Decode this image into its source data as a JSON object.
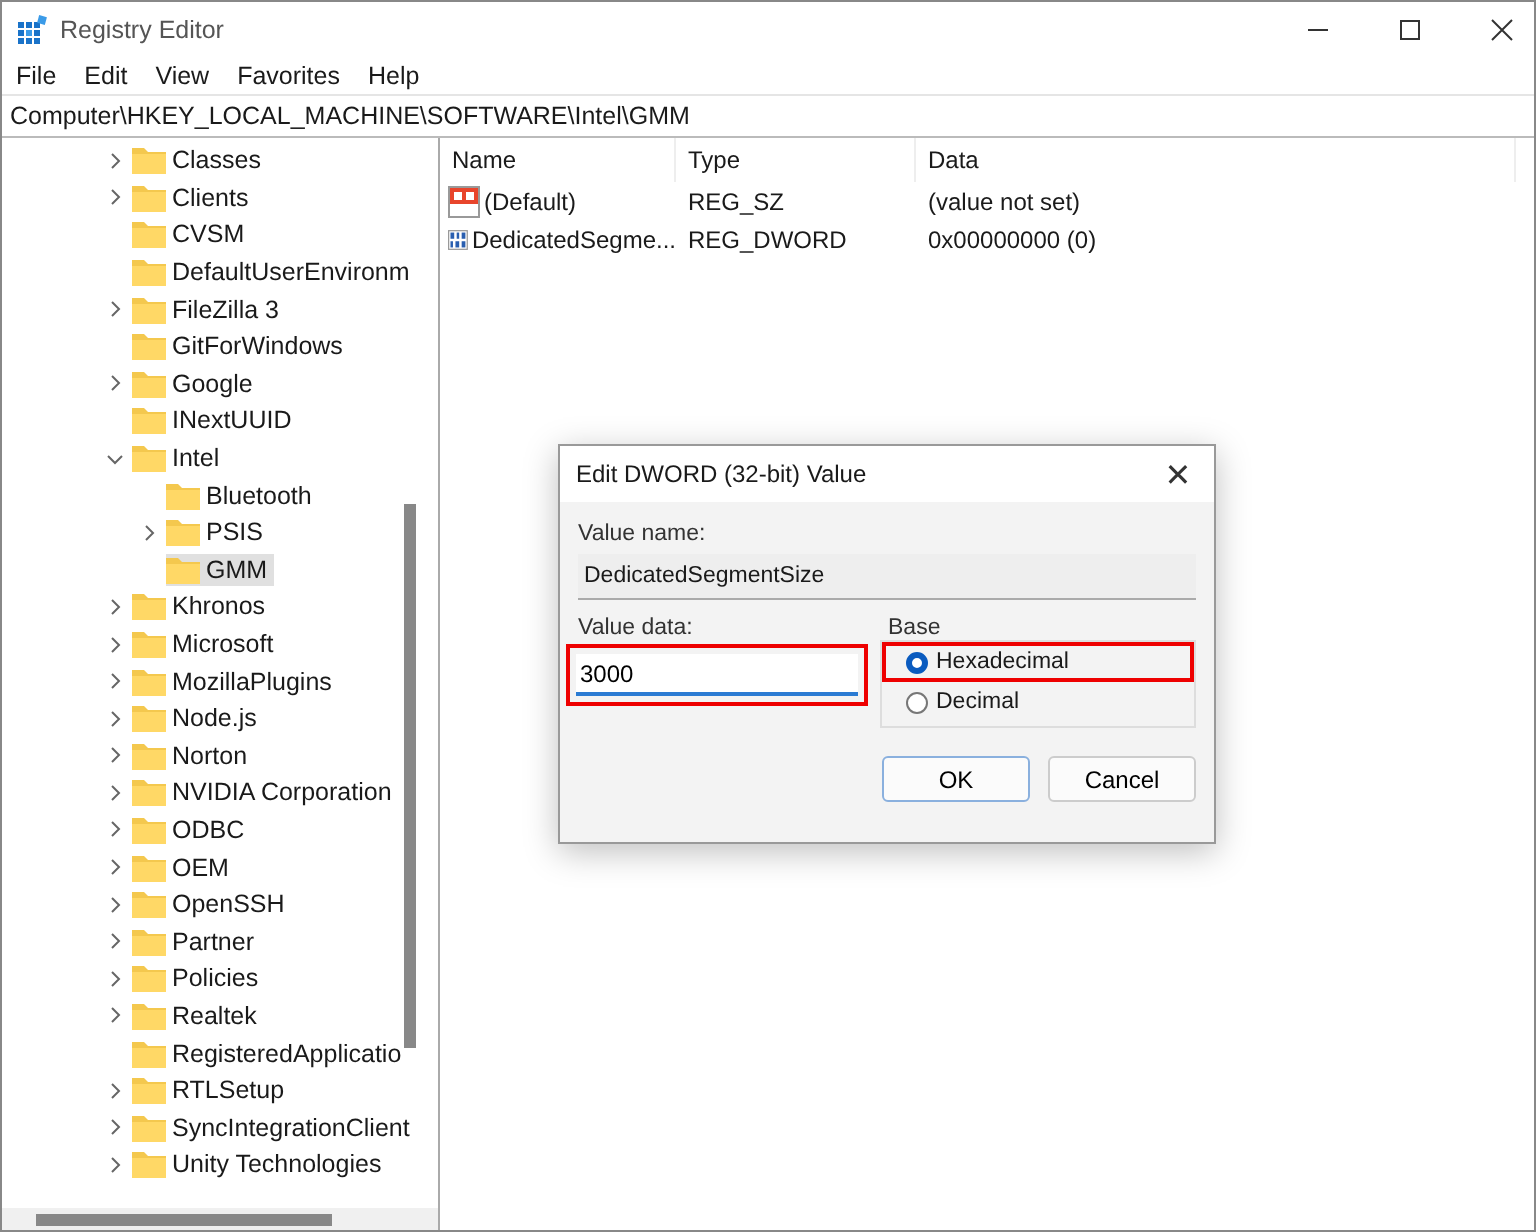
{
  "window": {
    "title": "Registry Editor"
  },
  "menu": [
    "File",
    "Edit",
    "View",
    "Favorites",
    "Help"
  ],
  "address": "Computer\\HKEY_LOCAL_MACHINE\\SOFTWARE\\Intel\\GMM",
  "tree": [
    {
      "label": "Classes",
      "has_children": true,
      "expanded": false,
      "selected": false
    },
    {
      "label": "Clients",
      "has_children": true,
      "expanded": false,
      "selected": false
    },
    {
      "label": "CVSM",
      "has_children": false,
      "selected": false
    },
    {
      "label": "DefaultUserEnvironm",
      "has_children": false,
      "selected": false
    },
    {
      "label": "FileZilla 3",
      "has_children": true,
      "expanded": false,
      "selected": false
    },
    {
      "label": "GitForWindows",
      "has_children": false,
      "selected": false
    },
    {
      "label": "Google",
      "has_children": true,
      "expanded": false,
      "selected": false
    },
    {
      "label": "INextUUID",
      "has_children": false,
      "selected": false
    },
    {
      "label": "Intel",
      "has_children": true,
      "expanded": true,
      "selected": false,
      "children": [
        {
          "label": "Bluetooth",
          "has_children": false,
          "selected": false
        },
        {
          "label": "PSIS",
          "has_children": true,
          "expanded": false,
          "selected": false
        },
        {
          "label": "GMM",
          "has_children": false,
          "selected": true
        }
      ]
    },
    {
      "label": "Khronos",
      "has_children": true,
      "expanded": false,
      "selected": false
    },
    {
      "label": "Microsoft",
      "has_children": true,
      "expanded": false,
      "selected": false
    },
    {
      "label": "MozillaPlugins",
      "has_children": true,
      "expanded": false,
      "selected": false
    },
    {
      "label": "Node.js",
      "has_children": true,
      "expanded": false,
      "selected": false
    },
    {
      "label": "Norton",
      "has_children": true,
      "expanded": false,
      "selected": false
    },
    {
      "label": "NVIDIA Corporation",
      "has_children": true,
      "expanded": false,
      "selected": false
    },
    {
      "label": "ODBC",
      "has_children": true,
      "expanded": false,
      "selected": false
    },
    {
      "label": "OEM",
      "has_children": true,
      "expanded": false,
      "selected": false
    },
    {
      "label": "OpenSSH",
      "has_children": true,
      "expanded": false,
      "selected": false
    },
    {
      "label": "Partner",
      "has_children": true,
      "expanded": false,
      "selected": false
    },
    {
      "label": "Policies",
      "has_children": true,
      "expanded": false,
      "selected": false
    },
    {
      "label": "Realtek",
      "has_children": true,
      "expanded": false,
      "selected": false
    },
    {
      "label": "RegisteredApplicatio",
      "has_children": false,
      "selected": false
    },
    {
      "label": "RTLSetup",
      "has_children": true,
      "expanded": false,
      "selected": false
    },
    {
      "label": "SyncIntegrationClient",
      "has_children": true,
      "expanded": false,
      "selected": false
    },
    {
      "label": "Unity Technologies",
      "has_children": true,
      "expanded": false,
      "selected": false
    }
  ],
  "table": {
    "columns": [
      "Name",
      "Type",
      "Data"
    ],
    "rows": [
      {
        "kind": "string",
        "name": "(Default)",
        "type": "REG_SZ",
        "data": "(value not set)"
      },
      {
        "kind": "binary",
        "name": "DedicatedSegme...",
        "type": "REG_DWORD",
        "data": "0x00000000 (0)"
      }
    ]
  },
  "dialog": {
    "title": "Edit DWORD (32-bit) Value",
    "close": "✕",
    "value_name_label": "Value name:",
    "value_name": "DedicatedSegmentSize",
    "value_data_label": "Value data:",
    "value_data": "3000",
    "value_data_highlighted": true,
    "base_label": "Base",
    "bases": [
      {
        "label": "Hexadecimal",
        "selected": true,
        "highlighted": true
      },
      {
        "label": "Decimal",
        "selected": false,
        "highlighted": false
      }
    ],
    "buttons": [
      "OK",
      "Cancel"
    ]
  }
}
